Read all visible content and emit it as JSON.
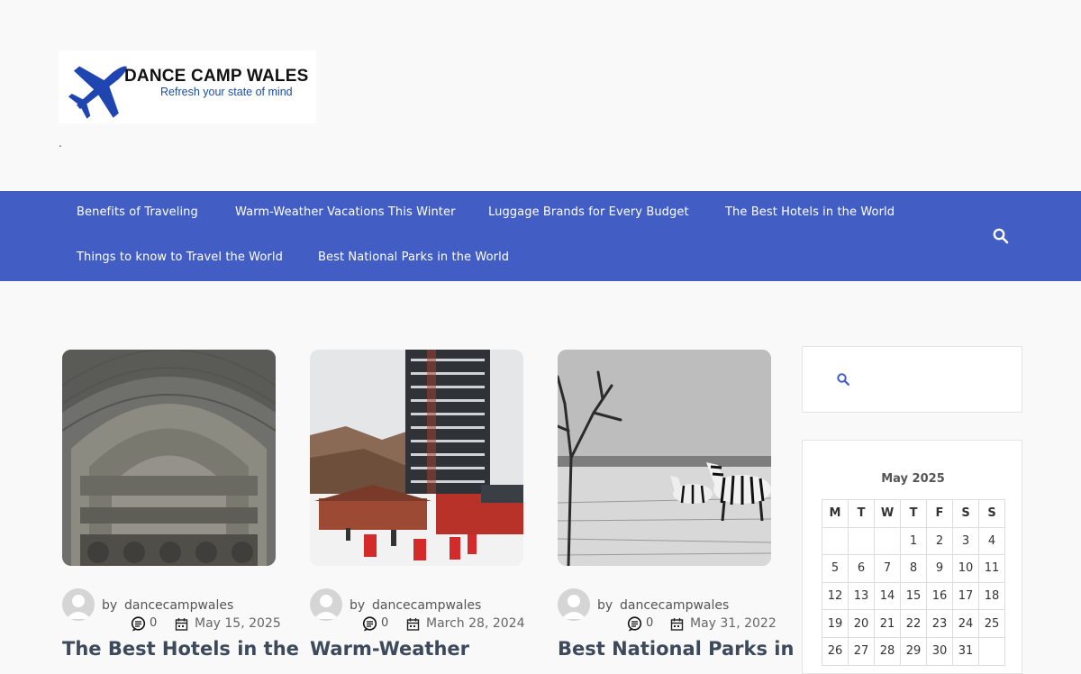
{
  "site": {
    "title": "DANCE CAMP WALES",
    "tagline": "Refresh your state of mind",
    "description": "."
  },
  "nav": {
    "items": [
      {
        "label": "Benefits of Traveling"
      },
      {
        "label": "Warm-Weather Vacations This Winter"
      },
      {
        "label": "Luggage Brands for Every Budget"
      },
      {
        "label": "The Best Hotels in the World"
      },
      {
        "label": "Things to know to Travel the World"
      },
      {
        "label": "Best National Parks in the World"
      }
    ]
  },
  "posts": [
    {
      "by": "by",
      "author": "dancecampwales",
      "comments": "0",
      "date": "May 15, 2025",
      "title": "The Best Hotels in the"
    },
    {
      "by": "by",
      "author": "dancecampwales",
      "comments": "0",
      "date": "March 28, 2024",
      "title": "Warm-Weather"
    },
    {
      "by": "by",
      "author": "dancecampwales",
      "comments": "0",
      "date": "May 31, 2022",
      "title": "Best National Parks in"
    }
  ],
  "calendar": {
    "caption": "May 2025",
    "headers": [
      "M",
      "T",
      "W",
      "T",
      "F",
      "S",
      "S"
    ],
    "weeks": [
      [
        "",
        "",
        "",
        "1",
        "2",
        "3",
        "4"
      ],
      [
        "5",
        "6",
        "7",
        "8",
        "9",
        "10",
        "11"
      ],
      [
        "12",
        "13",
        "14",
        "15",
        "16",
        "17",
        "18"
      ],
      [
        "19",
        "20",
        "21",
        "22",
        "23",
        "24",
        "25"
      ],
      [
        "26",
        "27",
        "28",
        "29",
        "30",
        "31",
        ""
      ]
    ]
  },
  "colors": {
    "nav_bg": "#425ec4",
    "logo_plane": "#1f45b0",
    "search_icon": "#425ec4"
  },
  "icons": {
    "nav_search": "search-icon",
    "sidebar_search": "search-icon",
    "comments": "comment-icon",
    "date": "calendar-icon"
  }
}
